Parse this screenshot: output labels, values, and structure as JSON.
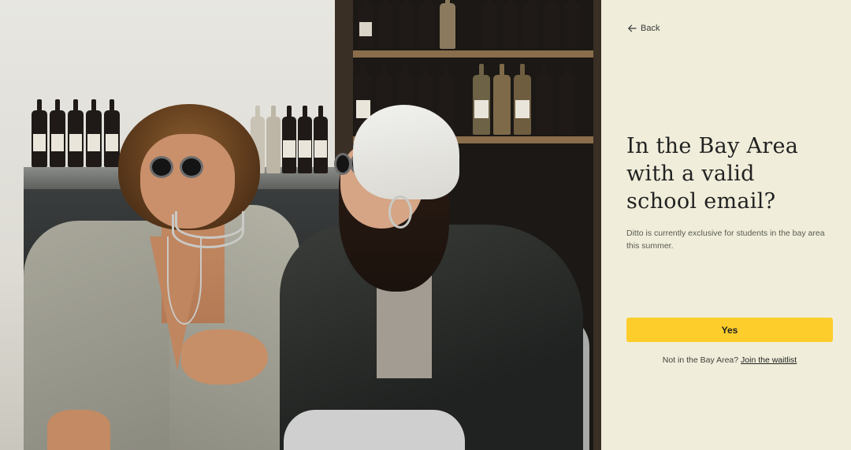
{
  "nav": {
    "back_label": "Back"
  },
  "panel": {
    "heading_lines": [
      "In the Bay Area",
      "with a valid",
      "school email?"
    ],
    "description": "Ditto is currently exclusive for students in the bay area this summer.",
    "primary_button": "Yes",
    "footer_prefix": "Not in the Bay Area?",
    "footer_link": "Join the waitlist"
  },
  "colors": {
    "panel_bg": "#f0eeda",
    "accent_yellow": "#fdcd2c",
    "text_dark": "#222222"
  },
  "icons": {
    "back": "arrow-left-icon"
  }
}
